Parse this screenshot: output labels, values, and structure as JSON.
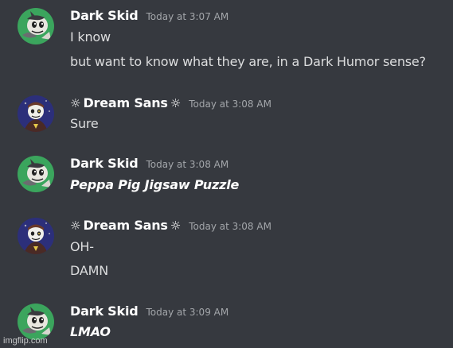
{
  "messages": [
    {
      "author": "Dark Skid",
      "decorated": false,
      "timestamp": "Today at 3:07 AM",
      "avatar_icon": "dark-skid-avatar-icon",
      "lines": [
        "I know",
        "but want to know what they are, in a Dark Humor sense?"
      ]
    },
    {
      "author": "Dream Sans",
      "decorated": true,
      "decoration_glyph": "☼",
      "timestamp": "Today at 3:08 AM",
      "avatar_icon": "dream-sans-avatar-icon",
      "lines": [
        "Sure"
      ]
    },
    {
      "author": "Dark Skid",
      "decorated": false,
      "timestamp": "Today at 3:08 AM",
      "avatar_icon": "dark-skid-avatar-icon",
      "lines": [
        "Peppa Pig Jigsaw Puzzle"
      ]
    },
    {
      "author": "Dream Sans",
      "decorated": true,
      "decoration_glyph": "☼",
      "timestamp": "Today at 3:08 AM",
      "avatar_icon": "dream-sans-avatar-icon",
      "lines": [
        "OH-",
        "DAMN"
      ]
    },
    {
      "author": "Dark Skid",
      "decorated": false,
      "timestamp": "Today at 3:09 AM",
      "avatar_icon": "dark-skid-avatar-icon",
      "lines": [
        "LMAO"
      ]
    }
  ],
  "watermark": "imgflip.com",
  "colors": {
    "background": "#36393f",
    "username": "#ffffff",
    "timestamp": "#a3a6aa",
    "message_text": "#dcddde",
    "skid_avatar_bg": "#3ba55d",
    "sans_avatar_bg": "#2c2f7a"
  }
}
